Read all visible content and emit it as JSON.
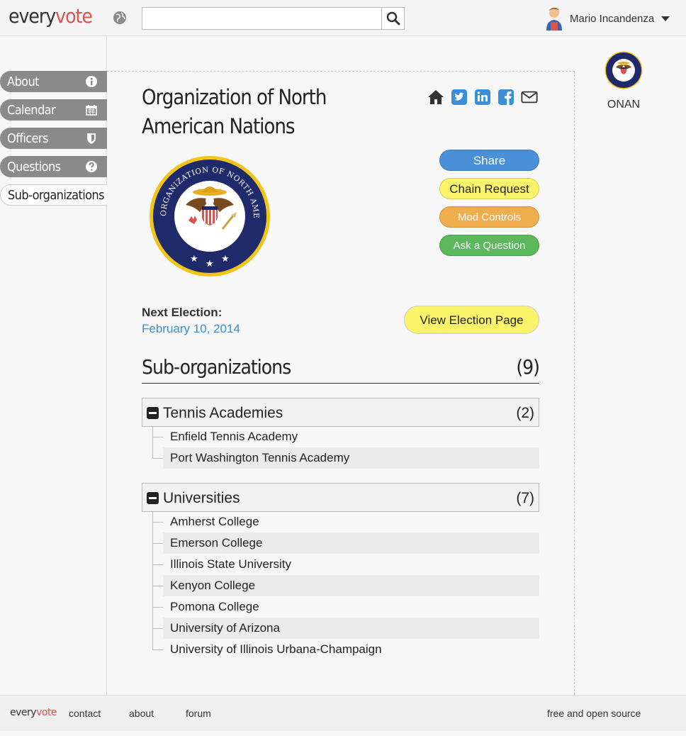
{
  "brand": {
    "part1": "every",
    "part2": "vote"
  },
  "header": {
    "search_placeholder": "",
    "user_name": "Mario Incandenza"
  },
  "sidebar": {
    "items": [
      {
        "label": "About",
        "icon": "info-icon"
      },
      {
        "label": "Calendar",
        "icon": "calendar-icon"
      },
      {
        "label": "Officers",
        "icon": "shield-icon"
      },
      {
        "label": "Questions",
        "icon": "question-icon"
      },
      {
        "label": "Sub-organizations",
        "icon": ""
      }
    ]
  },
  "org": {
    "title": "Organization of North American Nations",
    "abbr": "ONAN",
    "seal_text": "ORGANIZATION OF NORTH AMERICAN NATIONS"
  },
  "actions": {
    "share": "Share",
    "chain_request": "Chain Request",
    "mod_controls": "Mod Controls",
    "ask_question": "Ask a Question"
  },
  "election": {
    "label": "Next Election:",
    "date": "February 10, 2014",
    "view_button": "View Election Page"
  },
  "suborgs": {
    "heading": "Sub-organizations",
    "count": "(9)",
    "groups": [
      {
        "name": "Tennis Academies",
        "count": "(2)",
        "children": [
          "Enfield Tennis Academy",
          "Port Washington Tennis Academy"
        ]
      },
      {
        "name": "Universities",
        "count": "(7)",
        "children": [
          "Amherst College",
          "Emerson College",
          "Illinois State University",
          "Kenyon College",
          "Pomona College",
          "University of Arizona",
          "University of Illinois Urbana-Champaign"
        ]
      }
    ]
  },
  "footer": {
    "contact": "contact",
    "about": "about",
    "forum": "forum",
    "tagline": "free and open source"
  },
  "colors": {
    "accent_red": "#d9534f",
    "share_blue": "#4a90d9",
    "chain_yellow": "#fbf46b",
    "mod_orange": "#f0ad4e",
    "ask_green": "#5cb85c",
    "date_blue": "#3a8fd6"
  }
}
